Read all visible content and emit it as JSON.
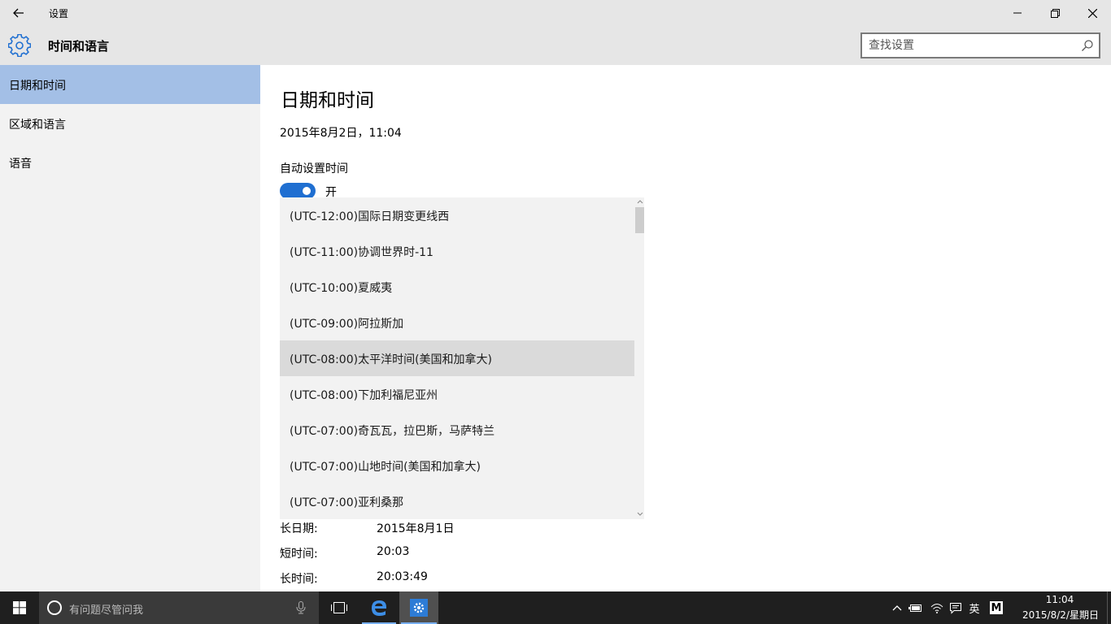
{
  "window": {
    "title": "设置"
  },
  "header": {
    "section_title": "时间和语言",
    "search_placeholder": "查找设置"
  },
  "sidebar": {
    "items": [
      {
        "label": "日期和时间",
        "active": true
      },
      {
        "label": "区域和语言",
        "active": false
      },
      {
        "label": "语音",
        "active": false
      }
    ]
  },
  "content": {
    "title": "日期和时间",
    "current_datetime": "2015年8月2日，11:04",
    "auto_time_label": "自动设置时间",
    "auto_time_state": "开",
    "timezone_options": [
      "(UTC-12:00)国际日期变更线西",
      "(UTC-11:00)协调世界时-11",
      "(UTC-10:00)夏威夷",
      "(UTC-09:00)阿拉斯加",
      "(UTC-08:00)太平洋时间(美国和加拿大)",
      "(UTC-08:00)下加利福尼亚州",
      "(UTC-07:00)奇瓦瓦，拉巴斯，马萨特兰",
      "(UTC-07:00)山地时间(美国和加拿大)",
      "(UTC-07:00)亚利桑那"
    ],
    "formats": [
      {
        "label": "长日期:",
        "value": "2015年8月1日"
      },
      {
        "label": "短时间:",
        "value": "20:03"
      },
      {
        "label": "长时间:",
        "value": "20:03:49"
      }
    ]
  },
  "taskbar": {
    "search_placeholder": "有问题尽管问我",
    "ime_label": "英",
    "ime_mode": "M",
    "clock_time": "11:04",
    "clock_date": "2015/8/2/星期日"
  },
  "colors": {
    "accent": "#1f6fd1",
    "nav_active": "#a3bfe6",
    "taskbar": "#1f1f1f"
  }
}
